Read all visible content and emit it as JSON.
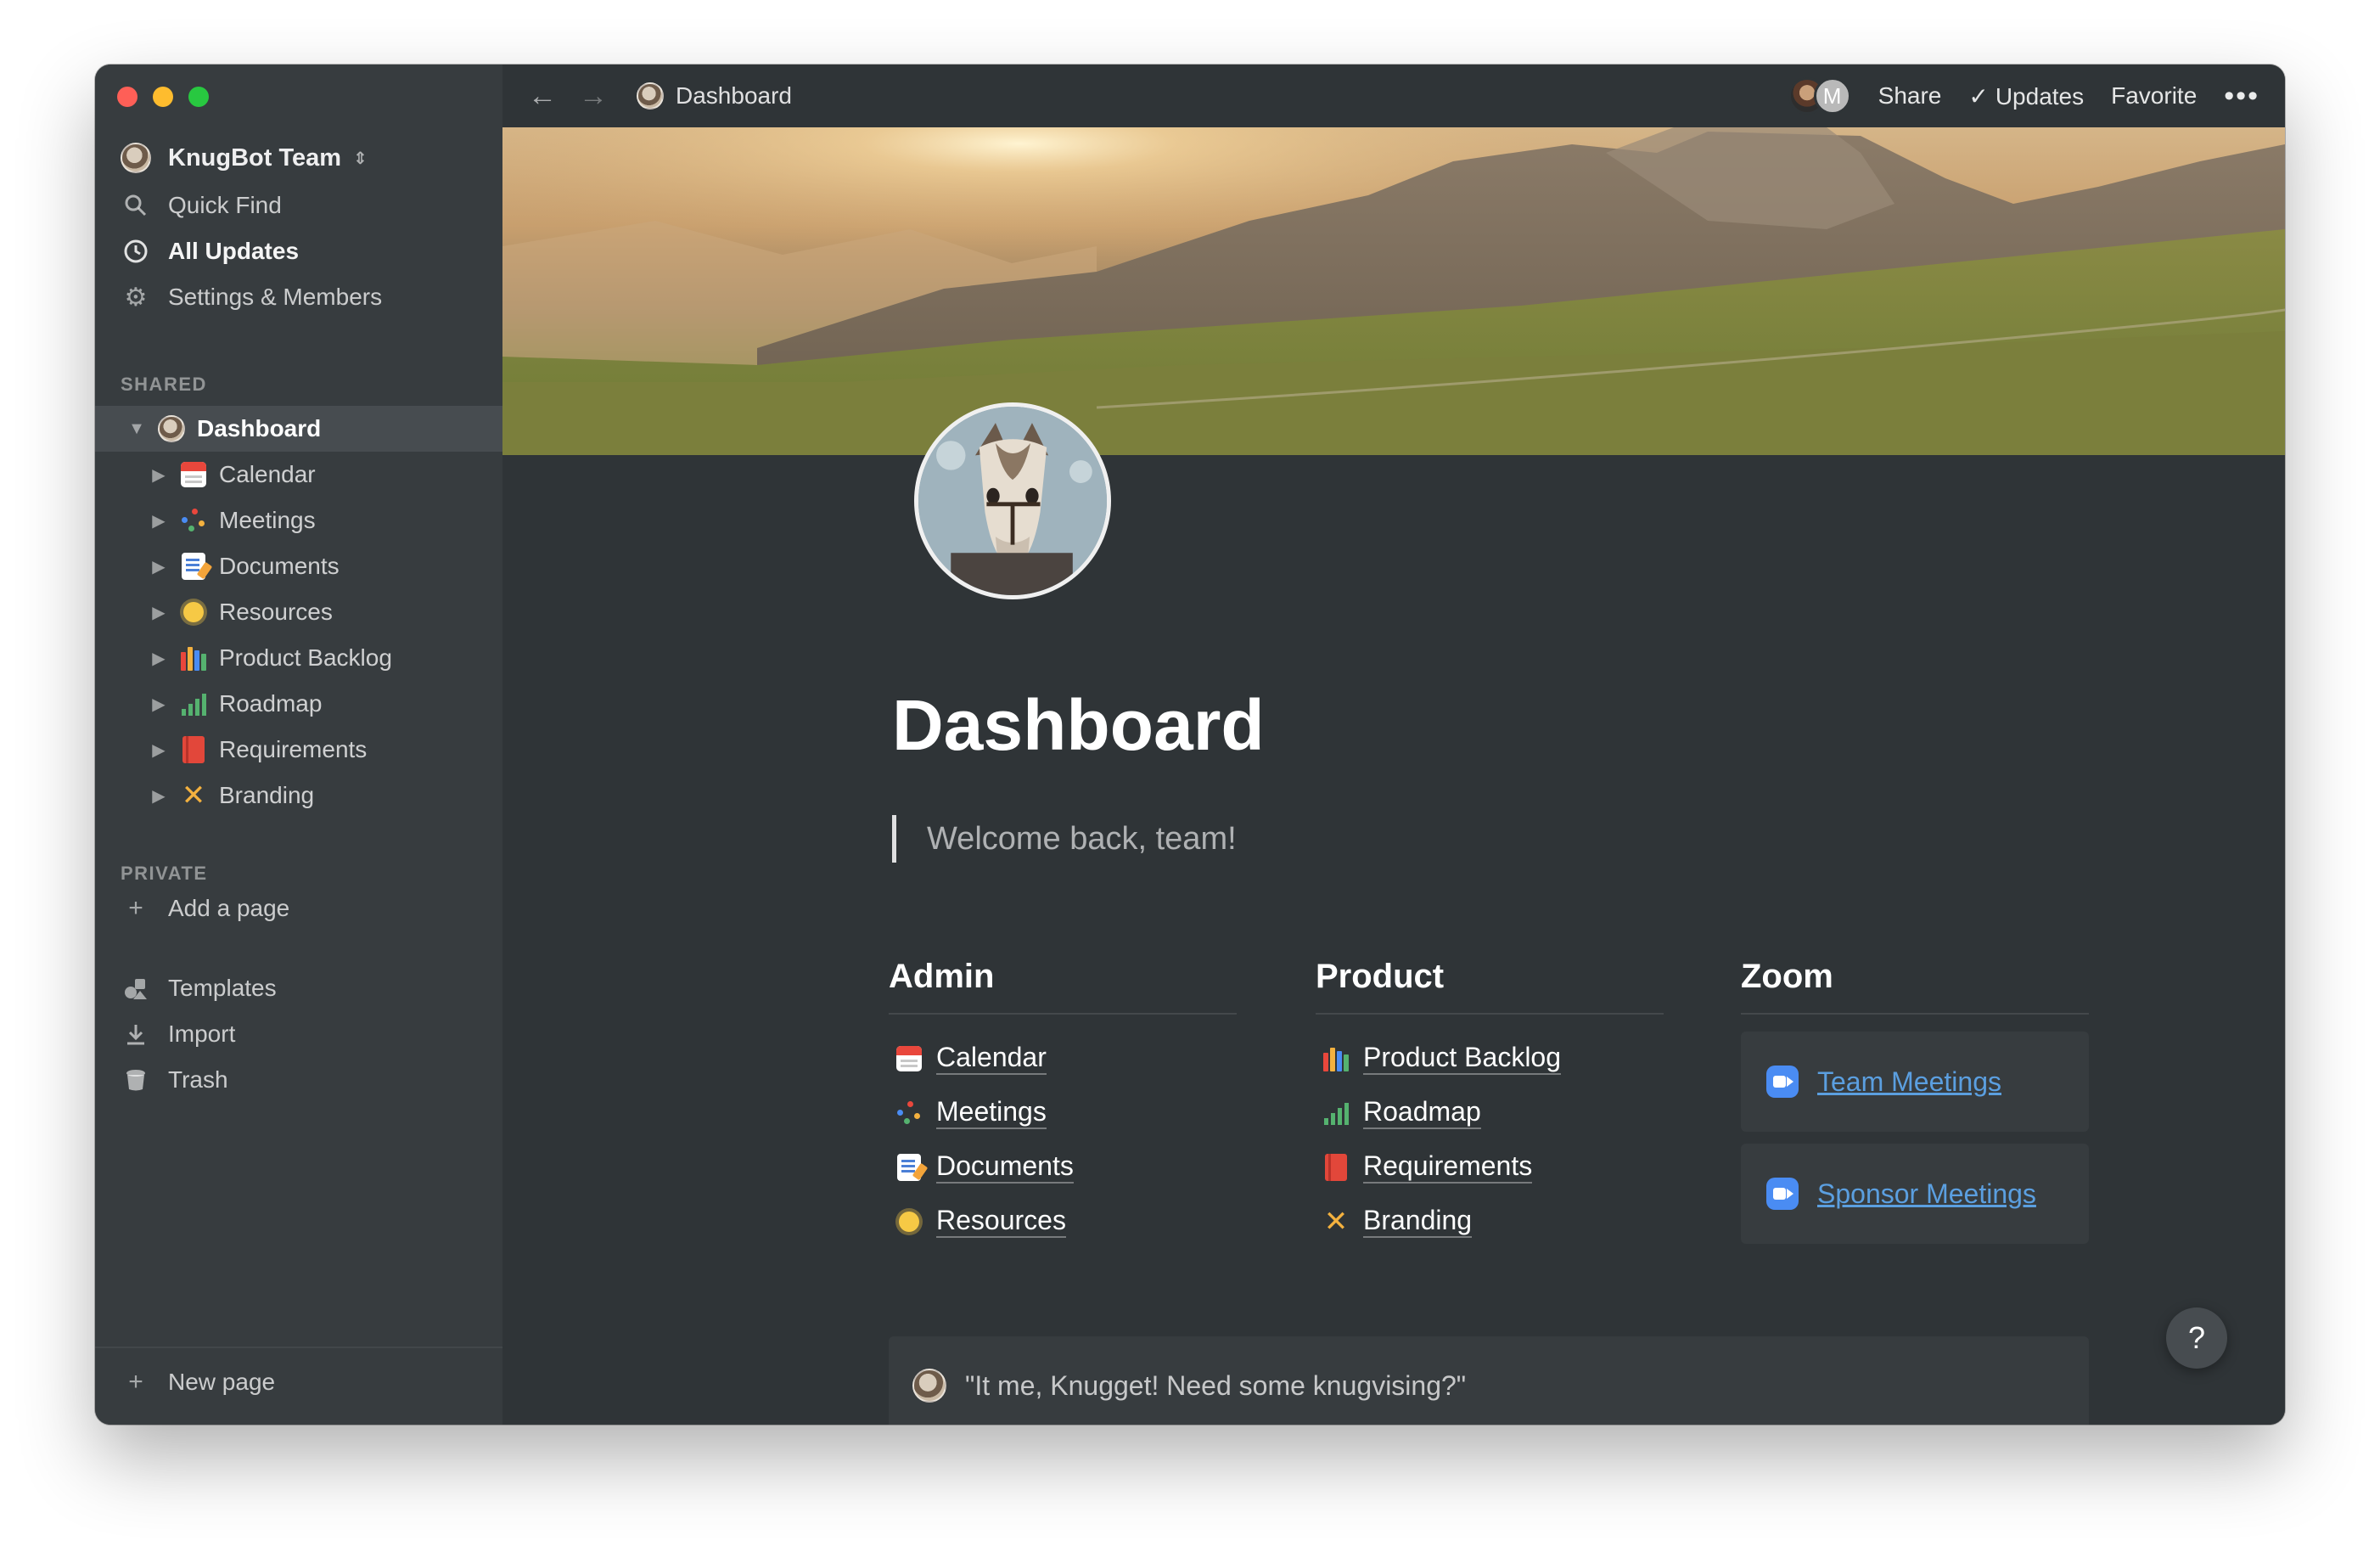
{
  "window": {
    "traffic_lights": [
      "close",
      "minimize",
      "zoom"
    ]
  },
  "sidebar": {
    "workspace": "KnugBot Team",
    "nav": [
      {
        "label": "Quick Find",
        "icon": "search-icon"
      },
      {
        "label": "All Updates",
        "icon": "clock-icon"
      },
      {
        "label": "Settings & Members",
        "icon": "gear-icon"
      }
    ],
    "shared_label": "SHARED",
    "tree": [
      {
        "label": "Dashboard",
        "icon": "knugget-avatar"
      },
      {
        "label": "Calendar",
        "icon": "calendar-icon"
      },
      {
        "label": "Meetings",
        "icon": "sparkle-dots-icon"
      },
      {
        "label": "Documents",
        "icon": "memo-icon"
      },
      {
        "label": "Resources",
        "icon": "sun-icon"
      },
      {
        "label": "Product Backlog",
        "icon": "books-icon"
      },
      {
        "label": "Roadmap",
        "icon": "signal-bars-icon"
      },
      {
        "label": "Requirements",
        "icon": "red-book-icon"
      },
      {
        "label": "Branding",
        "icon": "crossed-tools-icon"
      }
    ],
    "private_label": "PRIVATE",
    "add_page": "Add a page",
    "bottom_nav": [
      {
        "label": "Templates",
        "icon": "shapes-icon"
      },
      {
        "label": "Import",
        "icon": "download-icon"
      },
      {
        "label": "Trash",
        "icon": "trash-icon"
      }
    ],
    "new_page": "New page"
  },
  "topbar": {
    "breadcrumb": "Dashboard",
    "avatar_letter": "M",
    "share": "Share",
    "updates": "Updates",
    "favorite": "Favorite",
    "more": "•••"
  },
  "page": {
    "title": "Dashboard",
    "quote": "Welcome back, team!",
    "columns": {
      "admin": {
        "heading": "Admin",
        "links": [
          "Calendar",
          "Meetings",
          "Documents",
          "Resources"
        ]
      },
      "product": {
        "heading": "Product",
        "links": [
          "Product Backlog",
          "Roadmap",
          "Requirements",
          "Branding"
        ]
      },
      "zoom": {
        "heading": "Zoom",
        "links": [
          "Team Meetings",
          "Sponsor Meetings"
        ]
      }
    },
    "callout": "\"It me, Knugget! Need some knugvising?\"",
    "help": "?"
  },
  "colors": {
    "sidebar_bg": "#373c3f",
    "content_bg": "#2f3437",
    "selected_row": "#474c50",
    "zoom_link": "#5b9fe0",
    "zoom_brand": "#4a8cf3"
  }
}
